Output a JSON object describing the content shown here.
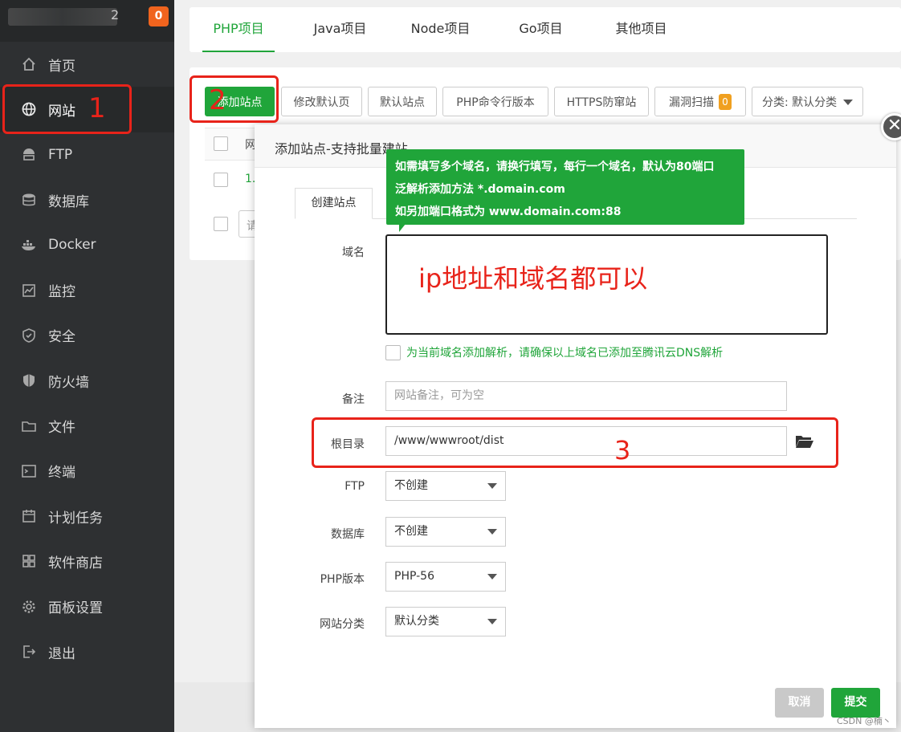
{
  "sidebar": {
    "user_tail": "2",
    "badge": "0",
    "items": [
      {
        "label": "首页",
        "icon": "home-icon"
      },
      {
        "label": "网站",
        "icon": "globe-icon"
      },
      {
        "label": "FTP",
        "icon": "ftp-icon"
      },
      {
        "label": "数据库",
        "icon": "database-icon"
      },
      {
        "label": "Docker",
        "icon": "docker-icon"
      },
      {
        "label": "监控",
        "icon": "monitor-icon"
      },
      {
        "label": "安全",
        "icon": "shield-icon"
      },
      {
        "label": "防火墙",
        "icon": "firewall-icon"
      },
      {
        "label": "文件",
        "icon": "folder-icon"
      },
      {
        "label": "终端",
        "icon": "terminal-icon"
      },
      {
        "label": "计划任务",
        "icon": "calendar-icon"
      },
      {
        "label": "软件商店",
        "icon": "apps-icon"
      },
      {
        "label": "面板设置",
        "icon": "gear-icon"
      },
      {
        "label": "退出",
        "icon": "logout-icon"
      }
    ],
    "active_index": 1
  },
  "tabs": [
    "PHP项目",
    "Java项目",
    "Node项目",
    "Go项目",
    "其他项目"
  ],
  "toolbar": {
    "add_site": "添加站点",
    "modify_default_page": "修改默认页",
    "default_site": "默认站点",
    "php_cli_version": "PHP命令行版本",
    "https_guard": "HTTPS防窜站",
    "vuln_scan": "漏洞扫描",
    "vuln_scan_badge": "0",
    "category_select": "分类: 默认分类"
  },
  "table": {
    "header_fragment": "网",
    "row_fragment": "1.",
    "footer_fragment": "请"
  },
  "modal": {
    "title": "添加站点-支持批量建站",
    "tab": "创建站点",
    "tooltip_lines": [
      "如需填写多个域名，请换行填写，每行一个域名，默认为80端口",
      "泛解析添加方法 *.domain.com",
      "如另加端口格式为 www.domain.com:88"
    ],
    "fields": {
      "domain_label": "域名",
      "dns_check_label": "为当前域名添加解析，请确保以上域名已添加至腾讯云DNS解析",
      "remark_label": "备注",
      "remark_placeholder": "网站备注，可为空",
      "root_label": "根目录",
      "root_value": "/www/wwwroot/dist",
      "ftp_label": "FTP",
      "ftp_value": "不创建",
      "db_label": "数据库",
      "db_value": "不创建",
      "php_label": "PHP版本",
      "php_value": "PHP-56",
      "category_label": "网站分类",
      "category_value": "默认分类"
    },
    "cancel": "取消",
    "submit": "提交",
    "close": "✕"
  },
  "annotations": {
    "n1": "1",
    "n2": "2",
    "n3": "3",
    "domain_note": "ip地址和域名都可以"
  },
  "watermark": "CSDN @楠丶",
  "colors": {
    "accent": "#20a53a",
    "annotation": "#e8231a",
    "sidebar_bg": "#2e3032",
    "badge": "#f0641e"
  }
}
